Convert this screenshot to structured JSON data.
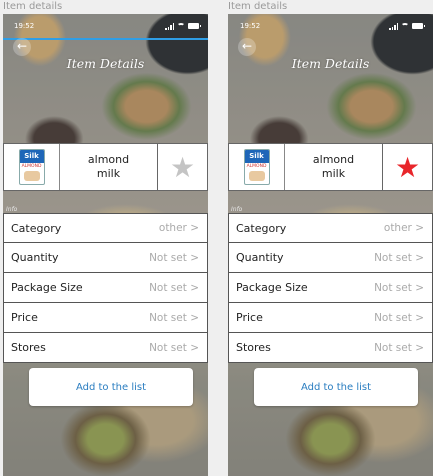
{
  "screens": [
    {
      "frame_label": "Item details",
      "status_time": "19:52",
      "header_title": "Item Details",
      "back_icon": "←",
      "item_name": "almond\nmilk",
      "carton_brand": "Silk",
      "carton_variety": "ALMOND",
      "favorite_star": "★",
      "favorite_color": "#c4c4c4",
      "info_tag": "Info",
      "rows": [
        {
          "label": "Category",
          "value": "other >"
        },
        {
          "label": "Quantity",
          "value": "Not set >"
        },
        {
          "label": "Package Size",
          "value": "Not set >"
        },
        {
          "label": "Price",
          "value": "Not set >"
        },
        {
          "label": "Stores",
          "value": "Not set >"
        }
      ],
      "add_button": "Add to the list"
    },
    {
      "frame_label": "Item details",
      "status_time": "19:52",
      "header_title": "Item Details",
      "back_icon": "←",
      "item_name": "almond\nmilk",
      "carton_brand": "Silk",
      "carton_variety": "ALMOND",
      "favorite_star": "★",
      "favorite_color": "#e8262b",
      "info_tag": "Info",
      "rows": [
        {
          "label": "Category",
          "value": "other >"
        },
        {
          "label": "Quantity",
          "value": "Not set >"
        },
        {
          "label": "Package Size",
          "value": "Not set >"
        },
        {
          "label": "Price",
          "value": "Not set >"
        },
        {
          "label": "Stores",
          "value": "Not set >"
        }
      ],
      "add_button": "Add to the list"
    }
  ]
}
